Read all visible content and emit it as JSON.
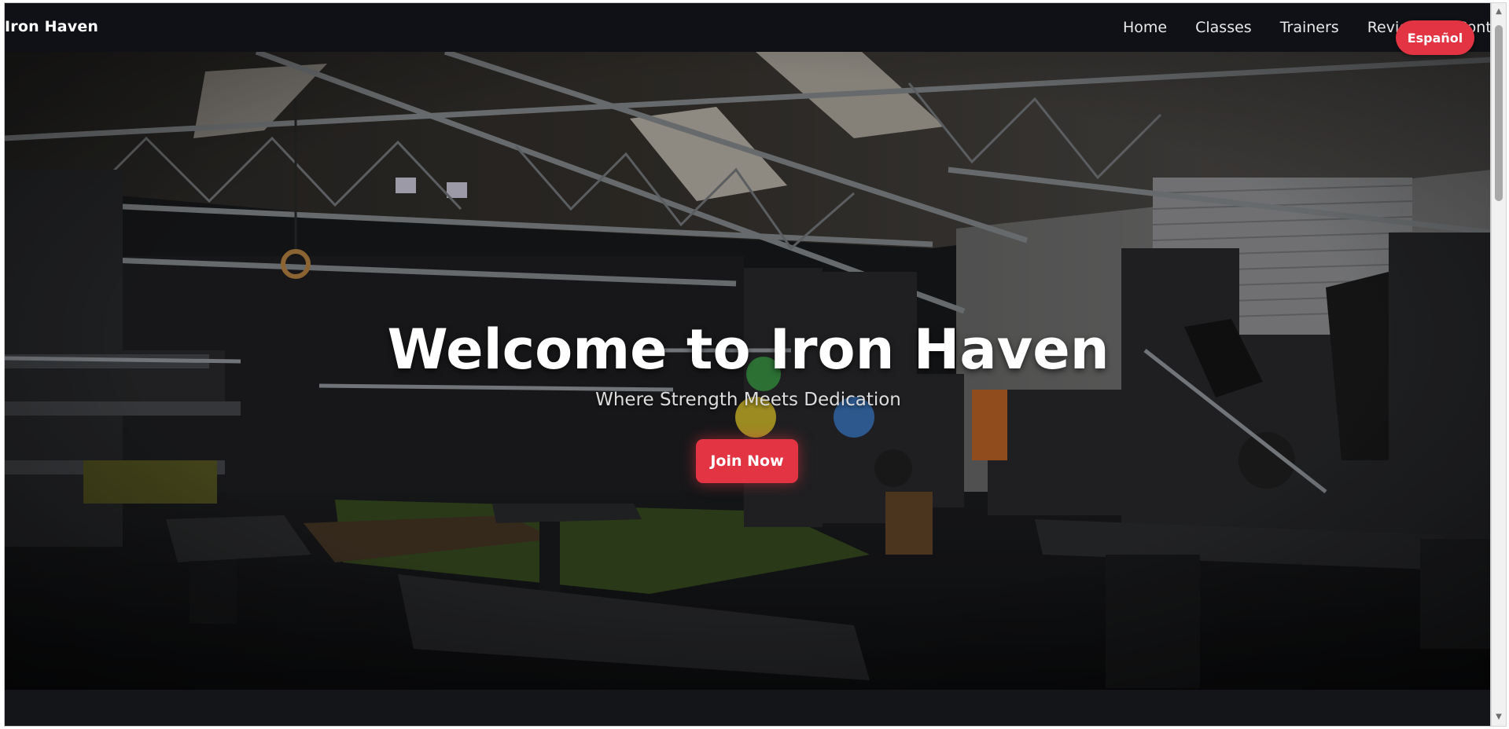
{
  "brand": {
    "name": "Iron Haven"
  },
  "nav": {
    "links": [
      "Home",
      "Classes",
      "Trainers",
      "Reviews",
      "Contact"
    ]
  },
  "language_toggle": {
    "label": "Español"
  },
  "hero": {
    "title": "Welcome to Iron Haven",
    "subtitle": "Where Strength Meets Dedication",
    "cta_label": "Join Now"
  },
  "colors": {
    "accent": "#e23443",
    "navbar_bg": "#0f1116"
  },
  "icons": {
    "scroll_up": "scroll-up-arrow-icon",
    "scroll_down": "scroll-down-arrow-icon"
  }
}
